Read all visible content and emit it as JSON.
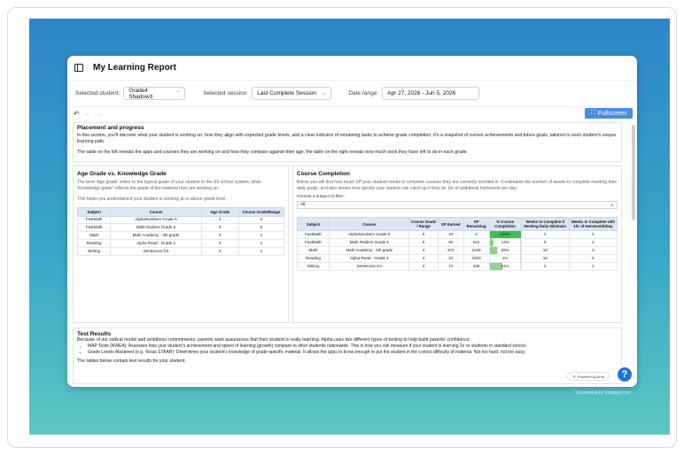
{
  "app": {
    "title": "My Learning Report"
  },
  "controls": {
    "student_label": "Selected student:",
    "student_value": "Grade4 Shadow3",
    "session_label": "Selected session:",
    "session_value": "Last Complete Session",
    "date_label": "Date range:",
    "date_value": "Apr 27, 2026 - Jun 5, 2026"
  },
  "toolbar": {
    "fullscreen_label": "Fullscreen"
  },
  "placement": {
    "title": "Placement and progress",
    "intro": "In this section, you'll discover what your student is working on, how they align with expected grade levels, and a clear indicator of remaining tasks to achieve grade completion. It's a snapshot of current achievements and future goals, tailored to each student's unique learning path.",
    "table_note": "The table on the left reveals the apps and courses they are working on and how they compare against their age; the table on the right reveals how much work they have left to do in each grade."
  },
  "age_grade": {
    "title": "Age Grade vs. Knowledge Grade",
    "desc": "The term 'Age grade' refers to the typical grade of your student in the US school system, while 'Knowledge grade' reflects the grade of the material they are working on.",
    "help": "This helps you understand if your student is working at or above grade level.",
    "headers": [
      "Subject",
      "Course",
      "Age Grade",
      "Course Grade/Range"
    ],
    "rows": [
      [
        "FastMath",
        "AlphaNumbers Grade 5",
        "4",
        "5"
      ],
      [
        "FastMath",
        "Math Raiders Grade 5",
        "4",
        "5"
      ],
      [
        "Math",
        "Math Academy - 4th grade",
        "4",
        "4"
      ],
      [
        "Reading",
        "Alpha Read - Grade 4",
        "4",
        "4"
      ],
      [
        "Writing",
        "Sentences G4",
        "4",
        "4"
      ]
    ]
  },
  "course_completion": {
    "title": "Course Completion",
    "desc": "Below you will find how much XP your student needs to complete courses they are currently enrolled in. It estimates the number of weeks to complete meeting their daily goals, and also shows how quickly your student can catch up if they do 1hr of additional homework per day.",
    "filter_label": "Choose a subject to filter:",
    "filter_value": "All",
    "headers": [
      "Subject",
      "Course",
      "Course Grade / Range",
      "XP Earned",
      "XP Remaining",
      "% Course Completion",
      "Weeks to Complete if Meeting Daily Minimum",
      "Weeks to Complete with 1hr of Homework/Day"
    ],
    "rows": [
      [
        "FastMath",
        "AlphaNumbers Grade 5",
        "5",
        "33",
        "0",
        "100%",
        "0",
        "0"
      ],
      [
        "FastMath",
        "Math Raiders Grade 5",
        "5",
        "94",
        "612",
        "13%",
        "5",
        "2"
      ],
      [
        "Math",
        "Math Academy - 4th grade",
        "4",
        "372",
        "1245",
        "26%",
        "10",
        "3"
      ],
      [
        "Reading",
        "Alpha Read - Grade 4",
        "4",
        "24",
        "1920",
        "1%",
        "16",
        "5"
      ],
      [
        "Writing",
        "Sentences G4",
        "4",
        "74",
        "106",
        "41%",
        "2",
        "1"
      ]
    ],
    "completion_fraction": [
      1.0,
      0.13,
      0.26,
      0.01,
      0.41
    ],
    "completion_color": "#8fd28a",
    "completion_full_color": "#3cbf4a"
  },
  "test_results": {
    "title": "Test Results",
    "intro": "Because of our radical model and ambitious commitments, parents want assurances that their student is really learning.  Alpha uses two different types of testing to help build parents' confidence:",
    "bullets": [
      "MAP Tests (NWEA): Assesses how your student's achievement and speed of learning (growth) compare to other students nationwide.  This is how you can measure if your student is learning 2x vs students in standard school.",
      "Grade Levels Mastered (e.g. Texas STAAR): Determines your student's knowledge of grade-specific material.  It allows the apps to know enough to put the student in the correct difficulty of material. Not too hard, not too easy."
    ],
    "footer": "The tables below contain test results for your student.",
    "powered_by": "Powered by Ama"
  },
  "watermark": "Screenshot by Xnapper.com",
  "colors": {
    "accent": "#4a8de0",
    "header_bg": "#dbe7f5",
    "help_button": "#1f72d6"
  }
}
